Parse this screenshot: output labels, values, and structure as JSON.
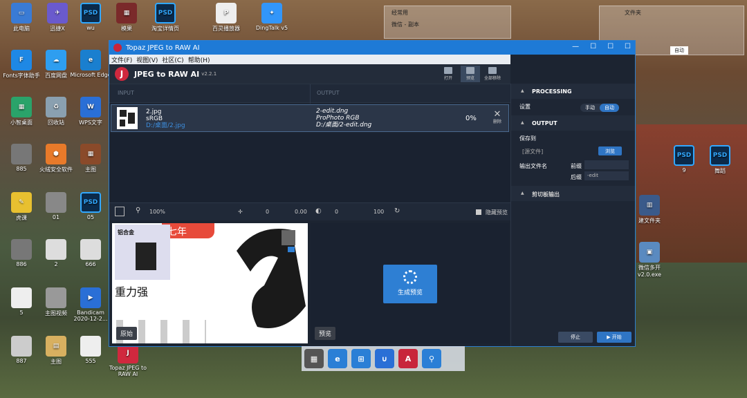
{
  "desktop": {
    "icons": [
      {
        "label": "此电脑",
        "color": "#3a7bd5",
        "glyph": "▭"
      },
      {
        "label": "迅捷X",
        "color": "#6a5acd",
        "glyph": "✈"
      },
      {
        "label": "wu",
        "color": "#0b2a4a",
        "glyph": "PSD"
      },
      {
        "label": "模果",
        "color": "#7a2a2a",
        "glyph": "▦"
      },
      {
        "label": "淘宝详情页",
        "color": "#0b2a4a",
        "glyph": "PSD"
      },
      {
        "label": "百灵播放器",
        "color": "#eeeeee",
        "glyph": "P"
      },
      {
        "label": "DingTalk v5",
        "color": "#3296fa",
        "glyph": "✦"
      },
      {
        "label": "Fonts字体助手",
        "color": "#1e88e5",
        "glyph": "F"
      },
      {
        "label": "百度网盘",
        "color": "#2e9ef0",
        "glyph": "☁"
      },
      {
        "label": "Microsoft Edge",
        "color": "#1a7fcf",
        "glyph": "e"
      },
      {
        "label": "小智桌面",
        "color": "#2aa36a",
        "glyph": "▦"
      },
      {
        "label": "回收站",
        "color": "#8aa0b0",
        "glyph": "♻"
      },
      {
        "label": "WPS文字",
        "color": "#2a6fd6",
        "glyph": "W"
      },
      {
        "label": "885",
        "color": "#777777",
        "glyph": ""
      },
      {
        "label": "火绒安全软件",
        "color": "#e87a2a",
        "glyph": "⬢"
      },
      {
        "label": "主图",
        "color": "#8a4a2a",
        "glyph": "▦"
      },
      {
        "label": "虎课",
        "color": "#e8c030",
        "glyph": "✎"
      },
      {
        "label": "01",
        "color": "#888888",
        "glyph": ""
      },
      {
        "label": "05",
        "color": "#0b2a4a",
        "glyph": "PSD"
      },
      {
        "label": "886",
        "color": "#777777",
        "glyph": ""
      },
      {
        "label": "2",
        "color": "#dddddd",
        "glyph": ""
      },
      {
        "label": "666",
        "color": "#dddddd",
        "glyph": ""
      },
      {
        "label": "5",
        "color": "#eeeeee",
        "glyph": ""
      },
      {
        "label": "主图视频",
        "color": "#999999",
        "glyph": ""
      },
      {
        "label": "Bandicam 2020-12-2...",
        "color": "#2a6fd6",
        "glyph": "▶"
      },
      {
        "label": "887",
        "color": "#cccccc",
        "glyph": ""
      },
      {
        "label": "主图",
        "color": "#d8b060",
        "glyph": "▤"
      },
      {
        "label": "555",
        "color": "#eeeeee",
        "glyph": ""
      },
      {
        "label": "Topaz JPEG to RAW AI",
        "color": "#d0283e",
        "glyph": "J"
      },
      {
        "label": "9",
        "color": "#0b2a4a",
        "glyph": "PSD"
      },
      {
        "label": "舞蹈",
        "color": "#0b2a4a",
        "glyph": "PSD"
      },
      {
        "label": "建文件夹",
        "color": "#3a5a8a",
        "glyph": "▥"
      },
      {
        "label": "微信多开 v2.0.exe",
        "color": "#5a8ac0",
        "glyph": "▣"
      }
    ],
    "top_windows": [
      {
        "title": "经常用",
        "sub": "微信 - 副本"
      },
      {
        "title": "文件夹",
        "sub": "自动"
      }
    ],
    "taskbar": [
      "window-icon",
      "ie-icon",
      "edge-icon",
      "magnet-icon",
      "adobe-icon",
      "search-icon"
    ]
  },
  "app": {
    "window_title": "Topaz JPEG to RAW AI",
    "menu": [
      "文件(F)",
      "视图(V)",
      "社区(C)",
      "帮助(H)"
    ],
    "name": "JPEG to RAW AI",
    "version": "v2.2.1",
    "tools": [
      {
        "label": "打开"
      },
      {
        "label": "预览"
      },
      {
        "label": "全部移除"
      }
    ],
    "columns": {
      "input": "INPUT",
      "output": "OUTPUT"
    },
    "file": {
      "name": "2.jpg",
      "profile": "sRGB",
      "path": "D:/桌面/2.jpg",
      "out_name": "2-edit.dng",
      "out_profile": "ProPhoto RGB",
      "out_path": "D:/桌面/2-edit.dng",
      "progress": "0%",
      "progress_value": 0,
      "remove": "删除"
    },
    "preview_toolbar": {
      "zoom": "100%",
      "val1": "0",
      "val2": "0.00",
      "val3": "0",
      "val4": "100",
      "hide": "隐藏预览"
    },
    "preview": {
      "headline": "七年",
      "caption": "重力强",
      "badge": "铝合金",
      "original": "原始",
      "preview_label": "预览",
      "generate": "生成预览"
    },
    "panel": {
      "processing": "PROCESSING",
      "settings_label": "设置",
      "mode": [
        "手动",
        "自动"
      ],
      "output": "OUTPUT",
      "save_to": "保存到",
      "folder": "[源文件]",
      "browse": "浏览",
      "filename_label": "输出文件名",
      "prefix_label": "前缀",
      "prefix_value": "",
      "suffix_label": "后缀",
      "suffix_value": "-edit",
      "extra": "剪切板输出",
      "stop": "停止",
      "start": "开始"
    }
  }
}
